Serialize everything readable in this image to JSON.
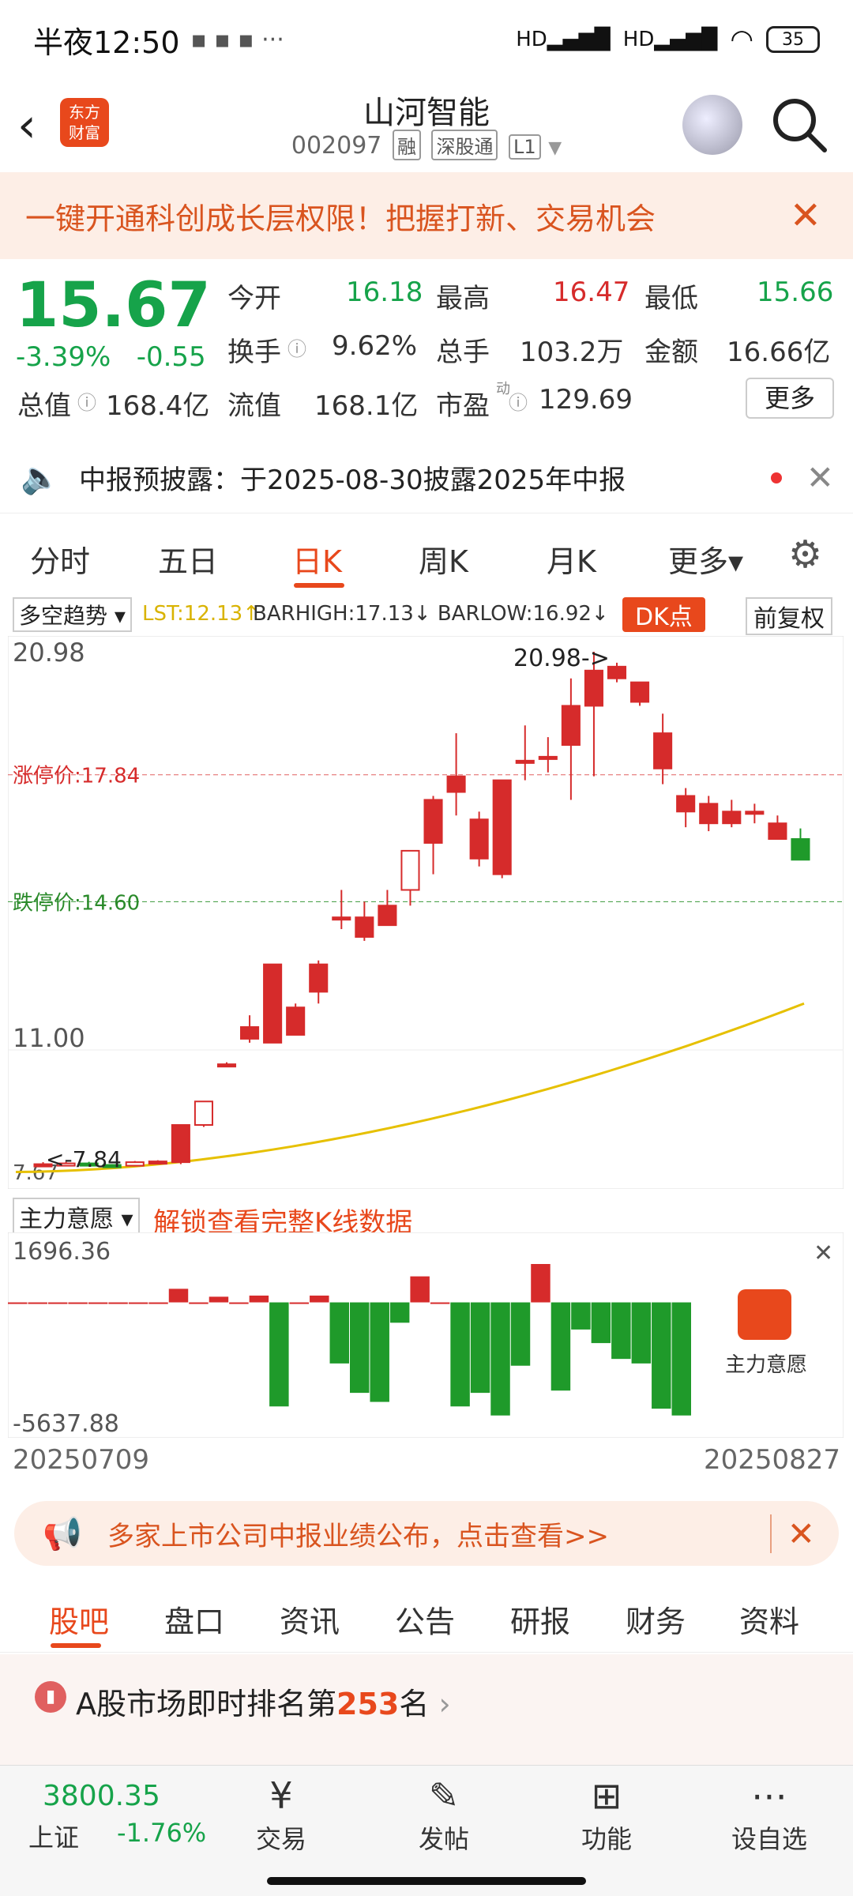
{
  "status": {
    "time": "半夜12:50",
    "battery": "35",
    "signal1": "HD",
    "signal2": "HD"
  },
  "header": {
    "title": "山河智能",
    "code": "002097",
    "tags": [
      "融",
      "深股通",
      "L1"
    ],
    "logo": "东方\n财富"
  },
  "banner": {
    "text": "一键开通科创成长层权限！把握打新、交易机会"
  },
  "quote": {
    "price": "15.67",
    "change_pct": "-3.39%",
    "change": "-0.55",
    "open_label": "今开",
    "open": "16.18",
    "high_label": "最高",
    "high": "16.47",
    "low_label": "最低",
    "low": "15.66",
    "turnover_label": "换手",
    "turnover": "9.62%",
    "volume_label": "总手",
    "volume": "103.2万",
    "amount_label": "金额",
    "amount": "16.66亿",
    "mktcap_label": "总值",
    "mktcap": "168.4亿",
    "float_label": "流值",
    "float": "168.1亿",
    "pe_label": "市盈",
    "pe_sup": "动",
    "pe": "129.69",
    "more": "更多"
  },
  "notice": {
    "text": "中报预披露：于2025-08-30披露2025年中报"
  },
  "tabs": [
    "分时",
    "五日",
    "日K",
    "周K",
    "月K",
    "更多▾"
  ],
  "chart_header": {
    "indicator": "多空趋势 ▾",
    "lst": "LST:12.13↑",
    "bars": "BARHIGH:17.13↓ BARLOW:16.92↓",
    "dk": "DK点",
    "adjust": "前复权"
  },
  "chart_data": {
    "type": "candlestick",
    "y_top_label": "20.98",
    "y_mid_label": "11.00",
    "y_bottom_label": "7.67",
    "limit_up_label": "涨停价:17.84",
    "limit_down_label": "跌停价:14.60",
    "high_annotation": "20.98->",
    "low_annotation": "<-7.84",
    "ylim": [
      7.67,
      20.98
    ],
    "candles": [
      {
        "o": 7.84,
        "c": 7.9,
        "h": 7.95,
        "l": 7.84,
        "color": "red"
      },
      {
        "o": 7.9,
        "c": 7.92,
        "h": 7.96,
        "l": 7.88,
        "color": "red"
      },
      {
        "o": 7.92,
        "c": 7.88,
        "h": 7.96,
        "l": 7.86,
        "color": "green"
      },
      {
        "o": 7.88,
        "c": 7.86,
        "h": 7.9,
        "l": 7.84,
        "color": "green"
      },
      {
        "o": 7.86,
        "c": 7.95,
        "h": 7.98,
        "l": 7.85,
        "color": "red"
      },
      {
        "o": 7.95,
        "c": 7.97,
        "h": 8.0,
        "l": 7.92,
        "color": "red"
      },
      {
        "o": 7.95,
        "c": 8.9,
        "h": 8.9,
        "l": 7.9,
        "color": "red"
      },
      {
        "o": 8.9,
        "c": 9.5,
        "h": 9.5,
        "l": 8.85,
        "color": "red"
      },
      {
        "o": 10.45,
        "c": 10.45,
        "h": 10.5,
        "l": 10.4,
        "color": "red"
      },
      {
        "o": 11.1,
        "c": 11.4,
        "h": 11.7,
        "l": 11.0,
        "color": "red"
      },
      {
        "o": 13.0,
        "c": 11.0,
        "h": 13.0,
        "l": 11.0,
        "color": "red"
      },
      {
        "o": 11.2,
        "c": 11.9,
        "h": 12.0,
        "l": 11.2,
        "color": "red"
      },
      {
        "o": 12.3,
        "c": 13.0,
        "h": 13.1,
        "l": 12.0,
        "color": "red"
      },
      {
        "o": 14.2,
        "c": 14.2,
        "h": 14.9,
        "l": 13.9,
        "color": "red"
      },
      {
        "o": 14.2,
        "c": 13.7,
        "h": 14.6,
        "l": 13.6,
        "color": "red"
      },
      {
        "o": 14.0,
        "c": 14.5,
        "h": 14.9,
        "l": 14.0,
        "color": "red"
      },
      {
        "o": 14.9,
        "c": 15.9,
        "h": 15.9,
        "l": 14.5,
        "color": "red"
      },
      {
        "o": 16.1,
        "c": 17.2,
        "h": 17.3,
        "l": 15.3,
        "color": "red"
      },
      {
        "o": 17.4,
        "c": 17.8,
        "h": 18.9,
        "l": 16.8,
        "color": "red"
      },
      {
        "o": 16.7,
        "c": 15.7,
        "h": 16.9,
        "l": 15.5,
        "color": "red"
      },
      {
        "o": 15.3,
        "c": 17.7,
        "h": 17.7,
        "l": 15.2,
        "color": "red"
      },
      {
        "o": 18.2,
        "c": 18.2,
        "h": 19.1,
        "l": 17.7,
        "color": "red"
      },
      {
        "o": 18.3,
        "c": 18.3,
        "h": 18.8,
        "l": 17.9,
        "color": "red"
      },
      {
        "o": 18.6,
        "c": 19.6,
        "h": 20.3,
        "l": 17.2,
        "color": "red"
      },
      {
        "o": 19.6,
        "c": 20.5,
        "h": 20.98,
        "l": 17.8,
        "color": "red"
      },
      {
        "o": 20.6,
        "c": 20.3,
        "h": 20.7,
        "l": 20.2,
        "color": "red"
      },
      {
        "o": 20.2,
        "c": 19.7,
        "h": 20.2,
        "l": 19.6,
        "color": "red"
      },
      {
        "o": 18.9,
        "c": 18.0,
        "h": 19.4,
        "l": 17.6,
        "color": "red"
      },
      {
        "o": 17.3,
        "c": 16.9,
        "h": 17.5,
        "l": 16.5,
        "color": "red"
      },
      {
        "o": 16.6,
        "c": 17.1,
        "h": 17.3,
        "l": 16.4,
        "color": "red"
      },
      {
        "o": 16.9,
        "c": 16.6,
        "h": 17.2,
        "l": 16.5,
        "color": "red"
      },
      {
        "o": 16.9,
        "c": 16.9,
        "h": 17.1,
        "l": 16.6,
        "color": "red"
      },
      {
        "o": 16.6,
        "c": 16.2,
        "h": 16.8,
        "l": 16.2,
        "color": "red"
      },
      {
        "o": 16.2,
        "c": 15.67,
        "h": 16.47,
        "l": 15.66,
        "color": "green"
      }
    ]
  },
  "flow_header": {
    "indicator": "主力意愿 ▾",
    "unlock": "解锁查看完整K线数据"
  },
  "flow_data": {
    "type": "bar",
    "top_label": "1696.36",
    "bottom_label": "-5637.88",
    "widget_label": "主力意愿",
    "values": [
      0,
      0,
      0,
      0,
      0,
      0,
      0,
      0,
      600,
      0,
      250,
      0,
      300,
      -4600,
      0,
      300,
      -2700,
      -4000,
      -4400,
      -900,
      1150,
      0,
      -4600,
      -4000,
      -5000,
      -2800,
      1696,
      -3900,
      -1200,
      -1800,
      -2500,
      -2700,
      -4700,
      -5000
    ]
  },
  "dates": {
    "start": "20250709",
    "end": "20250827"
  },
  "promo": {
    "text": "多家上市公司中报业绩公布，点击查看>>"
  },
  "bottom_tabs": [
    "股吧",
    "盘口",
    "资讯",
    "公告",
    "研报",
    "财务",
    "资料"
  ],
  "rank": {
    "prefix": "A股市场即时排名第",
    "num": "253",
    "suffix": "名"
  },
  "footer": {
    "index_value": "3800.35",
    "index_name": "上证",
    "index_change": "-1.76%",
    "buttons": [
      "交易",
      "发帖",
      "功能",
      "设自选"
    ]
  }
}
